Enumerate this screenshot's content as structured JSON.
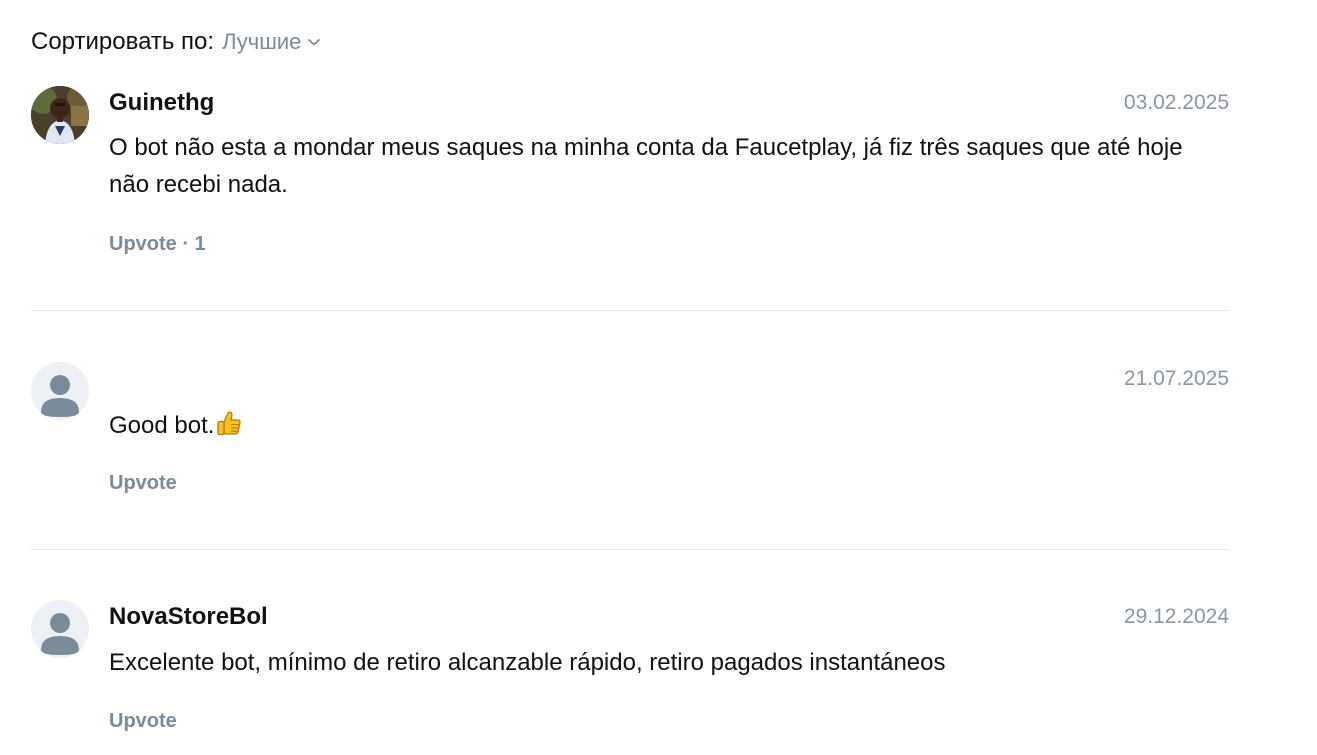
{
  "sort": {
    "label": "Сортировать по:",
    "selected": "Лучшие"
  },
  "comments": [
    {
      "author": "Guinethg",
      "date": "03.02.2025",
      "text": "O bot não esta a mondar meus saques na minha conta da Faucetplay, já fiz três saques que até hoje não recebi nada.",
      "upvote": "Upvote · 1",
      "avatar": "user-photo-avatar"
    },
    {
      "author": "",
      "date": "21.07.2025",
      "text": "Good bot.",
      "emoji": "thumbs-up-icon",
      "upvote": "Upvote",
      "avatar": "default-user-icon"
    },
    {
      "author": "NovaStoreBol",
      "date": "29.12.2024",
      "text": "Excelente bot, mínimo de retiro alcanzable rápido, retiro pagados instantáneos",
      "upvote": "Upvote",
      "avatar": "default-user-icon"
    }
  ],
  "colors": {
    "muted": "#8a96a1",
    "upvote": "#7c8b99",
    "divider": "#e3e6e9",
    "avatar_bg": "#edf1f5",
    "avatar_fg": "#7a8b99"
  }
}
